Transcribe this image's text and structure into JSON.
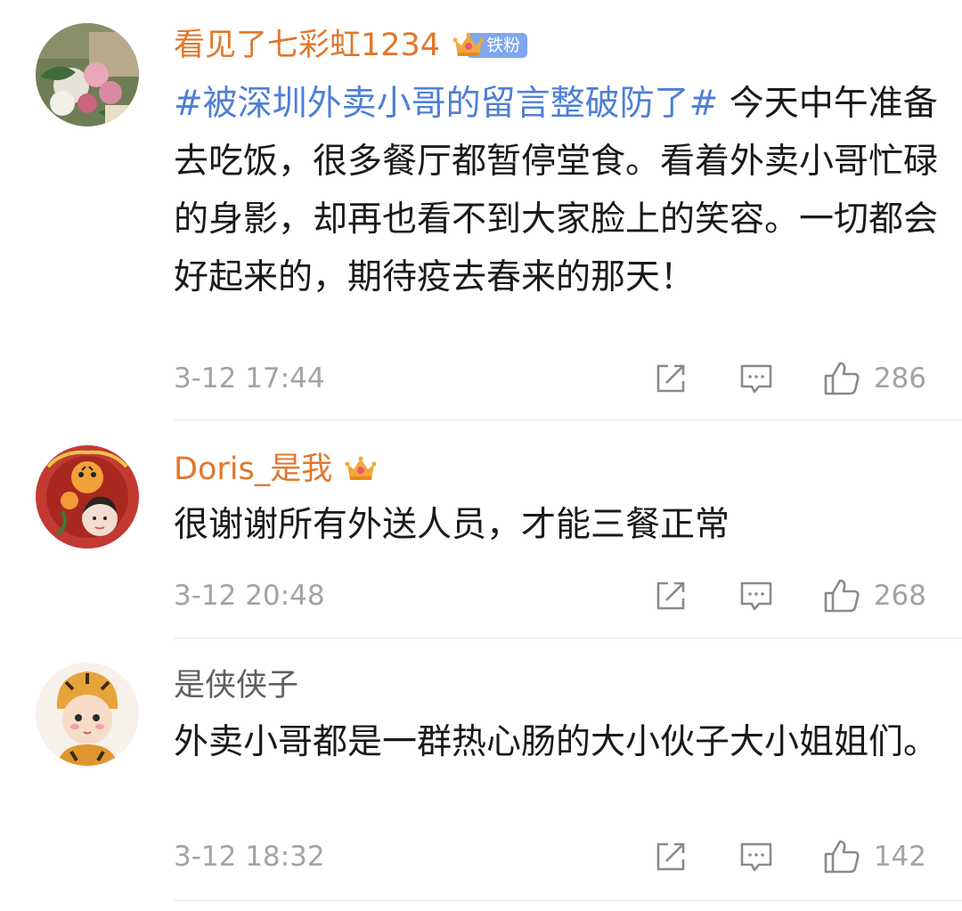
{
  "colors": {
    "vip_name": "#e2772b",
    "plain_name": "#5f5f5f",
    "topic_link": "#4f7fd6",
    "meta_text": "#a3a3a3",
    "fan_badge": "#7fa7f0",
    "divider": "#e6e6e6"
  },
  "icons": {
    "share": "share-icon",
    "comment": "comment-icon",
    "like": "thumbs-up-icon",
    "vip": "crown-icon"
  },
  "comments": [
    {
      "username": "看见了七彩虹1234",
      "fan_badge": "铁粉",
      "topic": "#被深圳外卖小哥的留言整破防了#",
      "text": " 今天中午准备去吃饭，很多餐厅都暂停堂食。看着外卖小哥忙碌的身影，却再也看不到大家脸上的笑容。一切都会好起来的，期待疫去春来的那天！",
      "time": "3-12 17:44",
      "likes": "286"
    },
    {
      "username": "Doris_是我",
      "text": "很谢谢所有外送人员，才能三餐正常",
      "time": "3-12 20:48",
      "likes": "268"
    },
    {
      "username": "是侠侠子",
      "text": "外卖小哥都是一群热心肠的大小伙子大小姐姐们。",
      "time": "3-12 18:32",
      "likes": "142"
    }
  ]
}
